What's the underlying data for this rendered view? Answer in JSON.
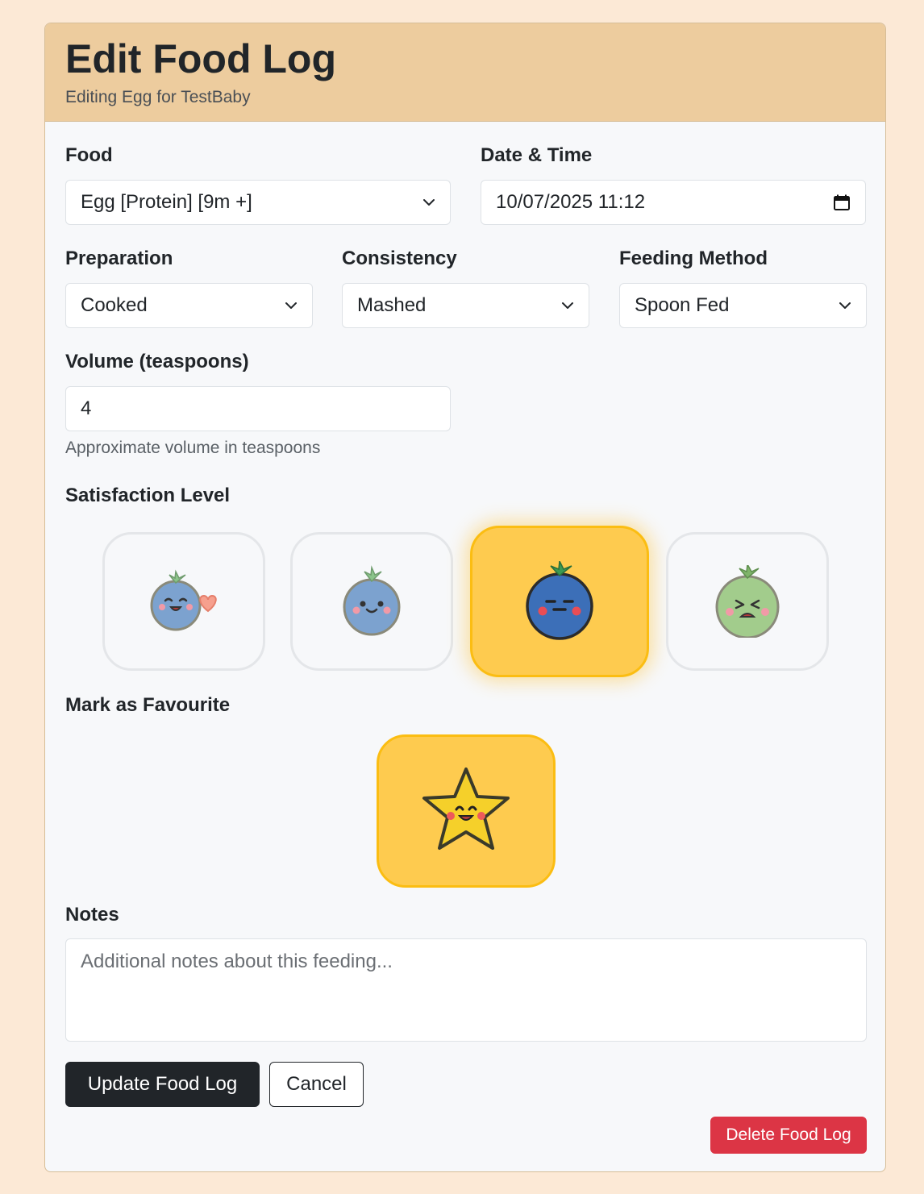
{
  "header": {
    "title": "Edit Food Log",
    "subtitle": "Editing Egg for TestBaby"
  },
  "form": {
    "food": {
      "label": "Food",
      "value": "Egg [Protein] [9m +]"
    },
    "datetime": {
      "label": "Date & Time",
      "value": "10/07/2025 11:12"
    },
    "preparation": {
      "label": "Preparation",
      "value": "Cooked"
    },
    "consistency": {
      "label": "Consistency",
      "value": "Mashed"
    },
    "feeding_method": {
      "label": "Feeding Method",
      "value": "Spoon Fed"
    },
    "volume": {
      "label": "Volume (teaspoons)",
      "value": "4",
      "help": "Approximate volume in teaspoons"
    },
    "satisfaction": {
      "label": "Satisfaction Level",
      "options": [
        {
          "icon": "blueberry-love-icon",
          "selected": false
        },
        {
          "icon": "blueberry-happy-icon",
          "selected": false
        },
        {
          "icon": "blueberry-neutral-icon",
          "selected": true
        },
        {
          "icon": "green-berry-disgusted-icon",
          "selected": false
        }
      ]
    },
    "favourite": {
      "label": "Mark as Favourite",
      "icon": "happy-star-icon",
      "selected": true
    },
    "notes": {
      "label": "Notes",
      "placeholder": "Additional notes about this feeding..."
    }
  },
  "actions": {
    "update_label": "Update Food Log",
    "cancel_label": "Cancel",
    "delete_label": "Delete Food Log"
  },
  "colors": {
    "page_bg": "#fce9d6",
    "header_bg": "#edcc9e",
    "selected_bg": "#fecb4f",
    "danger": "#dc3545",
    "primary_dark": "#212529"
  }
}
